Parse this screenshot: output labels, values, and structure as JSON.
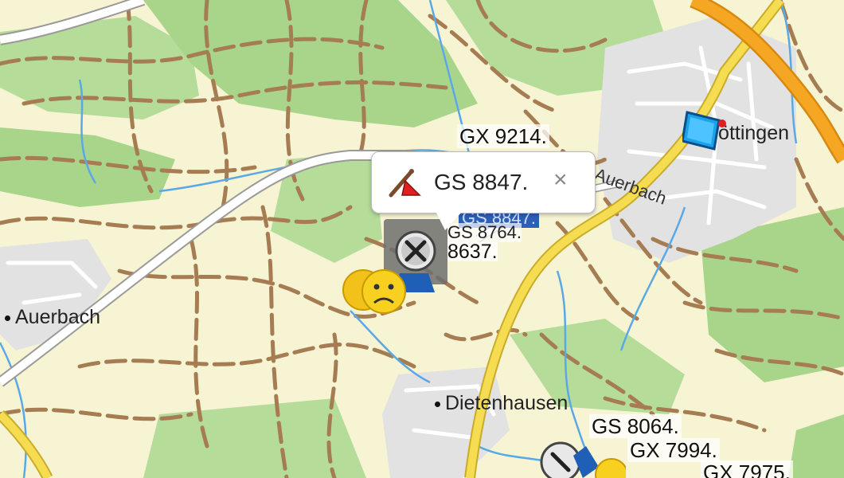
{
  "map": {
    "places": {
      "auerbach_west": "Auerbach",
      "nottingen": "Nöttingen",
      "dietenhausen": "Dietenhausen"
    },
    "road_label": "Auerbach",
    "cache_labels": {
      "gx9214": "GX 9214.",
      "gs8064": "GS 8064.",
      "gx7994": "GX 7994.",
      "gx7975": "GX 7975.",
      "gs8764": "GS 8764.",
      "gs8637": "8637.",
      "gs8847_hidden": "GS 8847."
    },
    "colors": {
      "land": "#f7f4d4",
      "forest": "#a9d58a",
      "track": "#a67c52",
      "main_road": "#f5dc50",
      "motorway": "#f5a623",
      "water": "#5aa9e6"
    }
  },
  "popup": {
    "title": "GS 8847.",
    "close": "×",
    "icon": "cache-flag-icon"
  }
}
